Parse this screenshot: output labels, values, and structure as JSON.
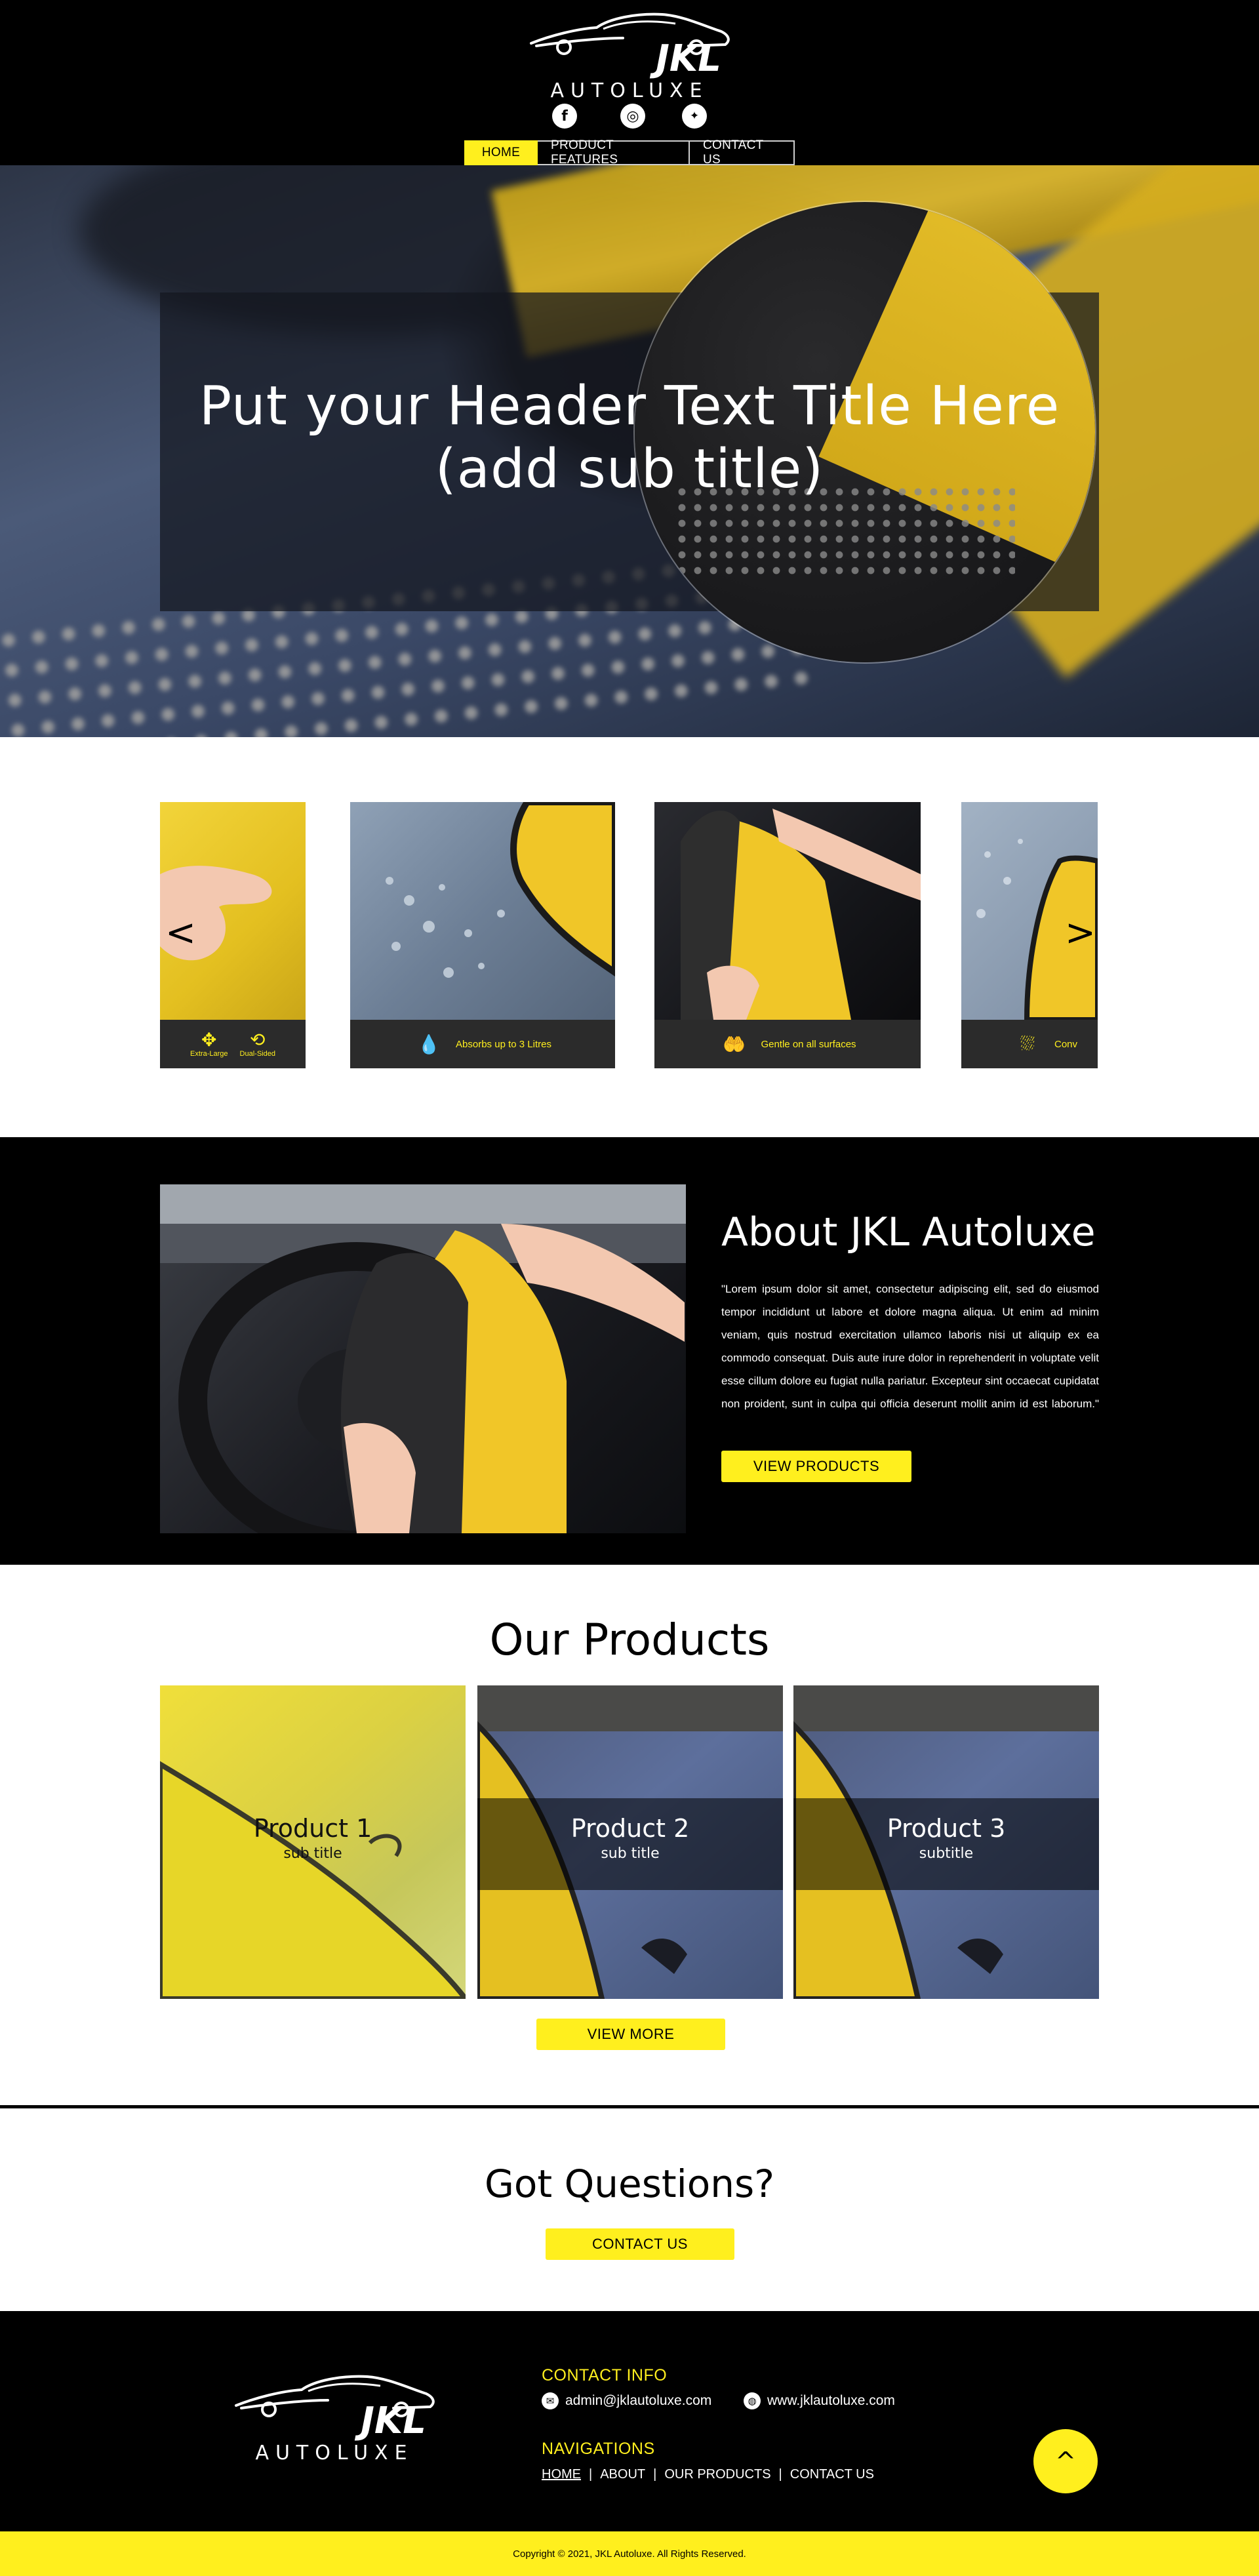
{
  "brand": {
    "logo_main": "JKL",
    "logo_sub": "AUTOLUXE",
    "accent": "#ffef1e",
    "dark": "#000000"
  },
  "social": [
    {
      "icon": "facebook-icon",
      "glyph": "f"
    },
    {
      "icon": "instagram-icon",
      "glyph": "◎"
    },
    {
      "icon": "twitter-icon",
      "glyph": "🐦"
    }
  ],
  "nav": {
    "home": "HOME",
    "features": "PRODUCT FEATURES",
    "contact": "CONTACT US"
  },
  "hero": {
    "title_line1": "Put your Header Text Title Here",
    "title_line2": "(add sub title)"
  },
  "carousel": {
    "prev": "<",
    "next": ">",
    "slides": [
      {
        "features": [
          {
            "label": "Extra-Large",
            "icon": "expand-arrows-icon"
          },
          {
            "label": "Dual-Sided",
            "icon": "repeat-arrows-icon"
          }
        ]
      },
      {
        "caption": "Absorbs up to 3 Litres",
        "icon": "water-drop-icon"
      },
      {
        "caption": "Gentle on all surfaces",
        "icon": "hand-leaf-icon"
      },
      {
        "caption": "Conv",
        "icon": "droplets-icon"
      }
    ]
  },
  "about": {
    "title": "About JKL Autoluxe",
    "text": "\"Lorem ipsum dolor sit amet, consectetur adipiscing elit, sed do eiusmod tempor incididunt ut labore et dolore magna aliqua. Ut enim ad minim veniam, quis nostrud exercitation ullamco laboris nisi ut aliquip ex ea commodo consequat. Duis aute irure dolor in reprehenderit in voluptate velit esse cillum dolore eu fugiat nulla pariatur. Excepteur sint occaecat cupidatat non proident, sunt in culpa qui officia deserunt mollit anim id est laborum.\"",
    "button": "VIEW PRODUCTS"
  },
  "products": {
    "title": "Our Products",
    "items": [
      {
        "title": "Product 1",
        "subtitle": "sub title"
      },
      {
        "title": "Product 2",
        "subtitle": "sub title"
      },
      {
        "title": "Product 3",
        "subtitle": "subtitle"
      }
    ],
    "button": "VIEW MORE"
  },
  "questions": {
    "title": "Got Questions?",
    "button": "CONTACT US"
  },
  "footer": {
    "contact_heading": "CONTACT INFO",
    "email": "admin@jklautoluxe.com",
    "website": "www.jklautoluxe.com",
    "nav_heading": "NAVIGATIONS",
    "nav": {
      "home": "HOME",
      "about": "ABOUT",
      "products": "OUR PRODUCTS",
      "contact": "CONTACT US",
      "sep": "|"
    },
    "to_top": "^",
    "copyright": "Copyright © 2021, JKL Autoluxe. All Rights Reserved."
  }
}
